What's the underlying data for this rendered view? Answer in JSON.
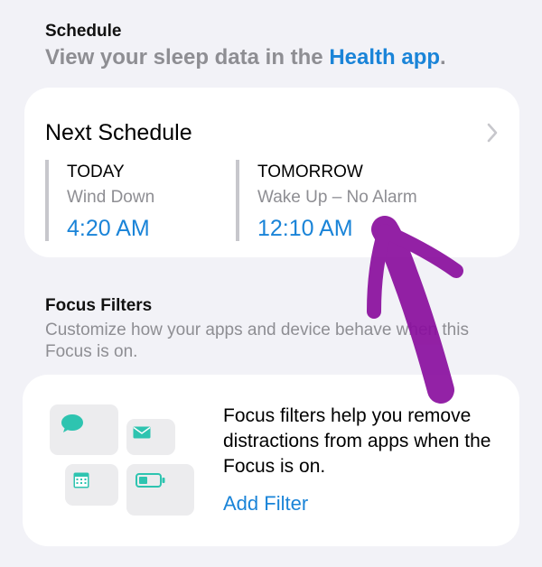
{
  "schedule_section": {
    "header": "Schedule",
    "subtitle_prefix": "View your sleep data in the ",
    "subtitle_link": "Health app",
    "subtitle_suffix": "."
  },
  "next_schedule": {
    "title": "Next Schedule",
    "items": [
      {
        "day": "TODAY",
        "label": "Wind Down",
        "time": "4:20 AM"
      },
      {
        "day": "TOMORROW",
        "label": "Wake Up – No Alarm",
        "time": "12:10 AM"
      }
    ]
  },
  "focus_filters": {
    "header": "Focus Filters",
    "description": "Customize how your apps and device behave when this Focus is on.",
    "card_text": "Focus filters help you remove distractions from apps when the Focus is on.",
    "add_filter_label": "Add Filter",
    "icons": [
      "message-icon",
      "mail-icon",
      "calendar-icon",
      "battery-icon"
    ]
  },
  "colors": {
    "background": "#f2f2f7",
    "accent_blue": "#1a84d8",
    "secondary_text": "#8e8e93",
    "icon_teal": "#2ec4b0",
    "annotation_purple": "#8a0f9e"
  }
}
